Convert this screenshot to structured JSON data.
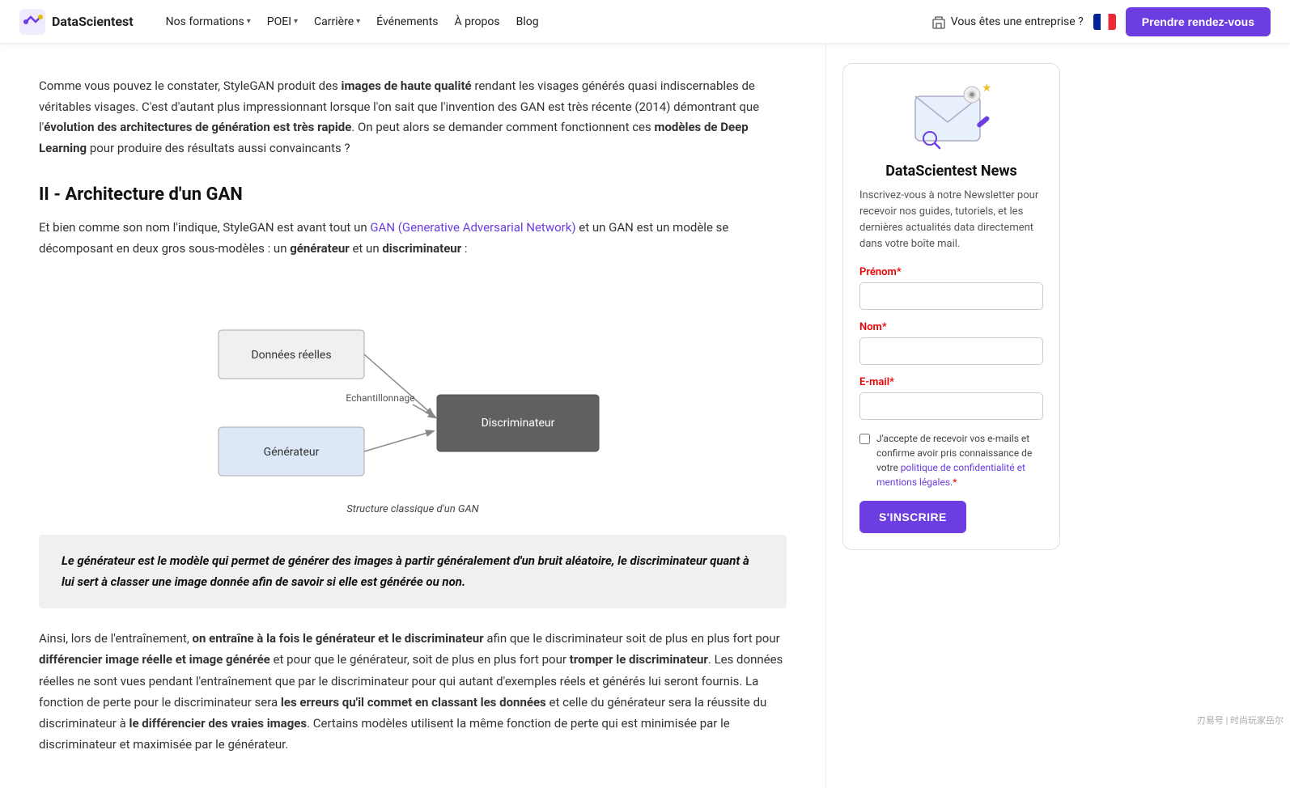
{
  "navbar": {
    "logo_text": "DataScientest",
    "nav_items": [
      {
        "label": "Nos formations",
        "has_dropdown": true
      },
      {
        "label": "POEI",
        "has_dropdown": true
      },
      {
        "label": "Carrière",
        "has_dropdown": true
      },
      {
        "label": "Événements",
        "has_dropdown": false
      },
      {
        "label": "À propos",
        "has_dropdown": false
      },
      {
        "label": "Blog",
        "has_dropdown": false
      }
    ],
    "entreprise_label": "Vous êtes une entreprise ?",
    "cta_label": "Prendre rendez-vous"
  },
  "intro_paragraph": "Comme vous pouvez le constater, StyleGAN produit des images de haute qualité rendant les visages générés quasi indiscernables de véritables visages. C'est d'autant plus impressionnant lorsque l'on sait que l'invention des GAN est très récente (2014) démontrant que l'évolution des architectures de génération est très rapide. On peut alors se demander comment fonctionnent ces modèles de Deep Learning pour produire des résultats aussi convaincants ?",
  "section_title": "II - Architecture d'un GAN",
  "section_intro": "Et bien comme son nom l'indique, StyleGAN est avant tout un GAN (Generative Adversarial Network) et un GAN est un modèle se décomposant en deux gros sous-modèles : un générateur et un discriminateur :",
  "diagram": {
    "caption": "Structure classique d'un GAN",
    "nodes": {
      "donnees_reelles": "Données réelles",
      "generateur": "Générateur",
      "echantillonnage": "Echantillonnage",
      "discriminateur": "Discriminateur"
    }
  },
  "highlight_text": "Le générateur est le modèle qui permet de générer des images à partir généralement d'un bruit aléatoire, le discriminateur quant à lui sert à classer une image donnée afin de savoir si elle est générée ou non.",
  "body_text_1": "Ainsi, lors de l'entraînement, on entraîne à la fois le générateur et le discriminateur afin que le discriminateur soit de plus en plus fort pour différencier image réelle et image générée et pour que le générateur, soit de plus en plus fort pour tromper le discriminateur. Les données réelles ne sont vues pendant l'entraînement que par le discriminateur pour qui autant d'exemples réels et générés lui seront fournis. La fonction de perte pour le discriminateur sera les erreurs qu'il commet en classant les données et celle du générateur sera la réussite du discriminateur à le différencier des vraies images. Certains modèles utilisent la même fonction de perte qui est minimisée par le discriminateur et maximisée par le générateur.",
  "sidebar": {
    "title": "DataScientest News",
    "desc": "Inscrivez-vous à notre Newsletter pour recevoir nos guides, tutoriels, et les dernières actualités data directement dans votre boîte mail.",
    "form": {
      "prenom_label": "Prénom",
      "prenom_required": "*",
      "nom_label": "Nom",
      "nom_required": "*",
      "email_label": "E-mail",
      "email_required": "*",
      "checkbox_text": "J'accepte de recevoir vos e-mails et confirme avoir pris connaissance de votre politique de confidentialité et mentions légales.",
      "checkbox_required": "*",
      "submit_label": "S'INSCRIRE"
    }
  }
}
